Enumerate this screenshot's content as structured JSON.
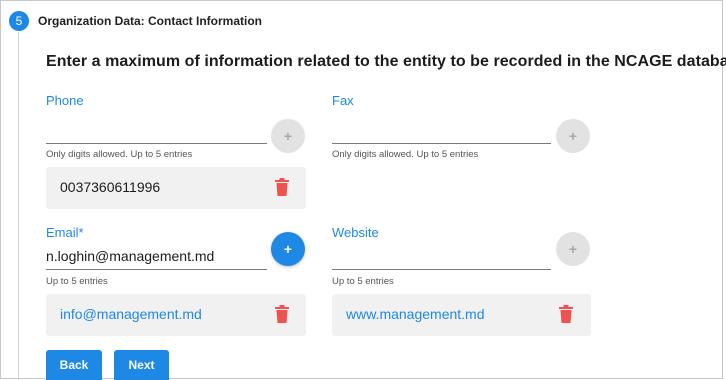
{
  "step": {
    "number": "5",
    "title": "Organization Data: Contact Information"
  },
  "heading": "Enter a maximum of information related to the entity to be recorded in the NCAGE database.",
  "phone": {
    "label": "Phone",
    "value": "",
    "helper": "Only digits allowed. Up to 5 entries",
    "add_label": "+",
    "entries": [
      "0037360611996"
    ]
  },
  "fax": {
    "label": "Fax",
    "value": "",
    "helper": "Only digits allowed. Up to 5 entries",
    "add_label": "+"
  },
  "email": {
    "label": "Email*",
    "value": "n.loghin@management.md",
    "helper": "Up to 5 entries",
    "add_label": "+",
    "entries": [
      "info@management.md"
    ]
  },
  "website": {
    "label": "Website",
    "value": "",
    "helper": "Up to 5 entries",
    "add_label": "+",
    "entries": [
      "www.management.md"
    ]
  },
  "buttons": {
    "back": "Back",
    "next": "Next"
  },
  "colors": {
    "accent": "#1e88e5",
    "delete": "#ef5350",
    "entry_bg": "#f1f1f1",
    "disabled": "#e2e2e2"
  },
  "icons": {
    "add": "plus-icon",
    "delete": "trash-icon"
  }
}
